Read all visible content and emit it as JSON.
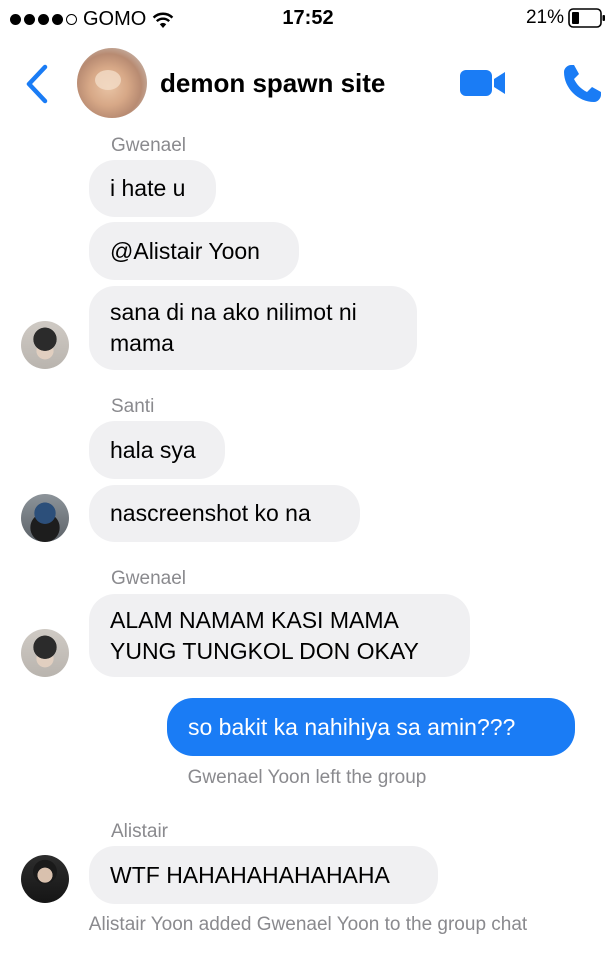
{
  "status_bar": {
    "carrier": "GOMO",
    "time": "17:52",
    "battery": "21%"
  },
  "header": {
    "title": "demon spawn site",
    "icons": [
      "back-icon",
      "group-avatar",
      "video-call-icon",
      "phone-call-icon"
    ],
    "accent_color": "#1a7cf5"
  },
  "messages": [
    {
      "sender": "Gwenael",
      "text": "i hate u"
    },
    {
      "text": "@Alistair Yoon"
    },
    {
      "line1": "sana di na ako nilimot ni",
      "line2": "mama"
    },
    {
      "sender": "Santi",
      "text": "hala sya"
    },
    {
      "text": "nascreenshot ko na"
    },
    {
      "sender": "Gwenael",
      "line1": "ALAM NAMAM KASI MAMA",
      "line2": "YUNG TUNGKOL DON OKAY"
    },
    {
      "text": "so bakit ka nahihiya sa amin???",
      "outgoing": true
    },
    {
      "system": "Gwenael Yoon left the group"
    },
    {
      "sender": "Alistair",
      "text": "WTF HAHAHAHAHAHAHA"
    },
    {
      "system": "Alistair Yoon added Gwenael Yoon to the group chat"
    }
  ]
}
